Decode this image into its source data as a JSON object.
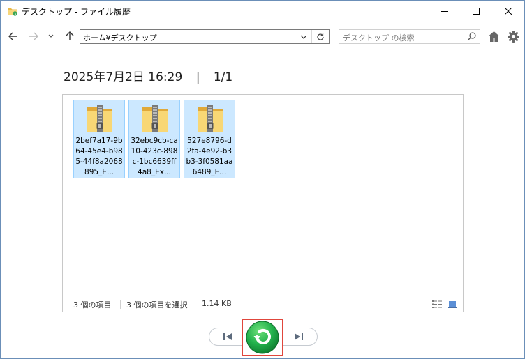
{
  "window": {
    "title": "デスクトップ - ファイル履歴",
    "icons": {
      "app": "folder-history-icon",
      "minimize": "minimize-icon",
      "maximize": "maximize-icon",
      "close": "close-icon"
    }
  },
  "navigation": {
    "address": "ホーム¥デスクトップ",
    "search_placeholder": "デスクトップ の検索",
    "icons": [
      "back-arrow-icon",
      "forward-arrow-icon",
      "recent-dropdown-icon",
      "up-arrow-icon",
      "chevron-down-icon",
      "refresh-icon",
      "search-icon",
      "home-icon",
      "gear-icon"
    ]
  },
  "snapshot": {
    "datetime": "2025年7月2日 16:29",
    "separator": "|",
    "page": "1/1"
  },
  "files": [
    {
      "name": "2bef7a17-9b64-45e4-b985-44f8a2068895_E...",
      "icon": "zip-folder-icon",
      "selected": true
    },
    {
      "name": "32ebc9cb-ca10-423c-898c-1bc6639ff4a8_Ex...",
      "icon": "zip-folder-icon",
      "selected": true
    },
    {
      "name": "527e8796-d2fa-4e92-b3b3-3f0581aa6489_E...",
      "icon": "zip-folder-icon",
      "selected": true
    }
  ],
  "status": {
    "item_count": "3 個の項目",
    "selected": "3 個の項目を選択",
    "size": "1.14 KB"
  },
  "controls": {
    "icons": {
      "previous": "previous-version-icon",
      "restore": "restore-icon",
      "next": "next-version-icon",
      "details_view": "details-view-icon",
      "large_icons_view": "large-icons-view-icon"
    },
    "colors": {
      "restore": "#22b14c",
      "highlight": "#e0463c",
      "selection": "#cce8ff"
    }
  }
}
